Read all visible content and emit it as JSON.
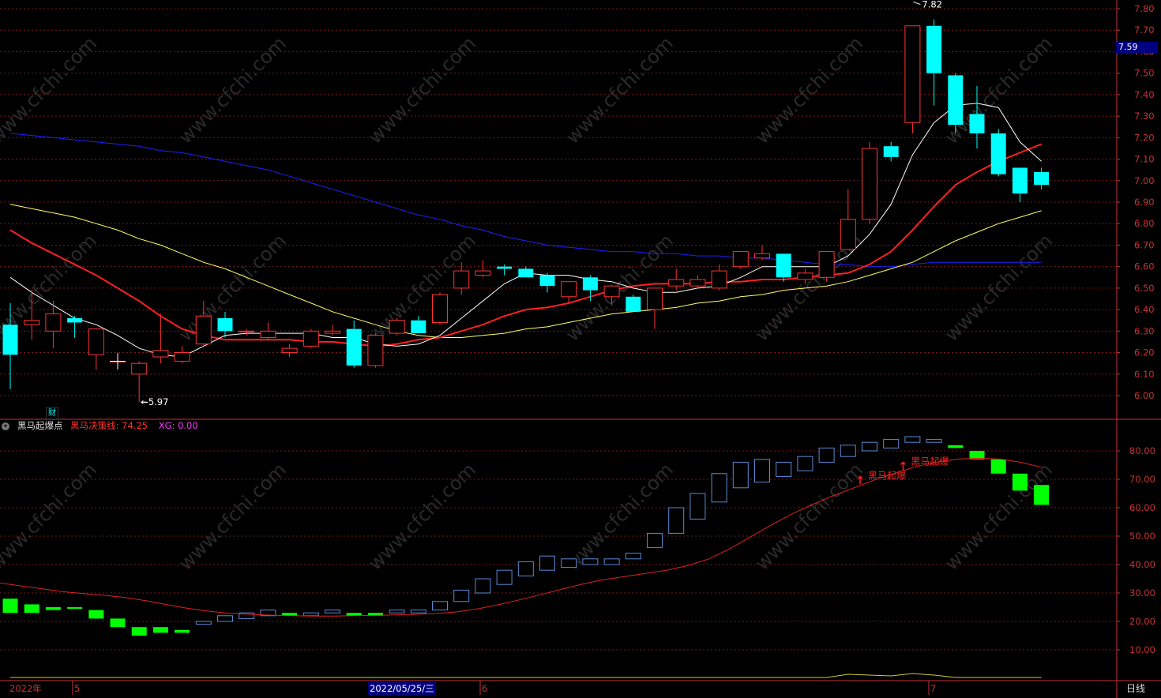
{
  "chart_data": {
    "type": "candlestick",
    "price_axis": {
      "ticks": [
        "7.80",
        "7.70",
        "7.60",
        "7.50",
        "7.40",
        "7.30",
        "7.20",
        "7.10",
        "7.00",
        "6.90",
        "6.80",
        "6.70",
        "6.60",
        "6.50",
        "6.40",
        "6.30",
        "6.20",
        "6.10",
        "6.00"
      ],
      "ylim": [
        5.9,
        7.85
      ]
    },
    "current_price": "7.59",
    "high_marker": "7.82",
    "low_marker": "5.97",
    "candles": [
      [
        6.33,
        6.43,
        6.03,
        6.19
      ],
      [
        6.33,
        6.49,
        6.26,
        6.35
      ],
      [
        6.3,
        6.44,
        6.22,
        6.38
      ],
      [
        6.36,
        6.37,
        6.27,
        6.34
      ],
      [
        6.19,
        6.31,
        6.12,
        6.31
      ],
      [
        6.16,
        6.2,
        6.12,
        6.16
      ],
      [
        6.1,
        6.16,
        5.97,
        6.15
      ],
      [
        6.18,
        6.38,
        6.15,
        6.21
      ],
      [
        6.16,
        6.23,
        6.15,
        6.2
      ],
      [
        6.24,
        6.44,
        6.23,
        6.37
      ],
      [
        6.36,
        6.39,
        6.27,
        6.3
      ],
      [
        6.3,
        6.31,
        6.28,
        6.3
      ],
      [
        6.27,
        6.34,
        6.26,
        6.3
      ],
      [
        6.2,
        6.24,
        6.18,
        6.22
      ],
      [
        6.23,
        6.31,
        6.22,
        6.3
      ],
      [
        6.29,
        6.33,
        6.28,
        6.3
      ],
      [
        6.31,
        6.35,
        6.13,
        6.14
      ],
      [
        6.14,
        6.29,
        6.13,
        6.28
      ],
      [
        6.29,
        6.36,
        6.28,
        6.35
      ],
      [
        6.35,
        6.37,
        6.29,
        6.29
      ],
      [
        6.34,
        6.48,
        6.33,
        6.47
      ],
      [
        6.5,
        6.62,
        6.47,
        6.58
      ],
      [
        6.56,
        6.63,
        6.55,
        6.58
      ],
      [
        6.6,
        6.61,
        6.56,
        6.59
      ],
      [
        6.59,
        6.6,
        6.55,
        6.55
      ],
      [
        6.56,
        6.57,
        6.48,
        6.51
      ],
      [
        6.46,
        6.53,
        6.43,
        6.53
      ],
      [
        6.55,
        6.56,
        6.44,
        6.49
      ],
      [
        6.46,
        6.51,
        6.42,
        6.51
      ],
      [
        6.46,
        6.47,
        6.39,
        6.39
      ],
      [
        6.4,
        6.47,
        6.31,
        6.5
      ],
      [
        6.51,
        6.59,
        6.49,
        6.54
      ],
      [
        6.51,
        6.56,
        6.5,
        6.54
      ],
      [
        6.5,
        6.61,
        6.49,
        6.58
      ],
      [
        6.6,
        6.67,
        6.59,
        6.67
      ],
      [
        6.64,
        6.7,
        6.63,
        6.66
      ],
      [
        6.66,
        6.66,
        6.53,
        6.55
      ],
      [
        6.54,
        6.59,
        6.52,
        6.57
      ],
      [
        6.55,
        6.67,
        6.53,
        6.67
      ],
      [
        6.68,
        6.96,
        6.68,
        6.82
      ],
      [
        6.82,
        7.18,
        6.8,
        7.15
      ],
      [
        7.16,
        7.18,
        7.09,
        7.11
      ],
      [
        7.27,
        7.31,
        7.22,
        7.72
      ],
      [
        7.72,
        7.75,
        7.35,
        7.5
      ],
      [
        7.49,
        7.5,
        7.22,
        7.26
      ],
      [
        7.31,
        7.44,
        7.15,
        7.22
      ],
      [
        7.22,
        7.24,
        7.02,
        7.03
      ],
      [
        7.06,
        7.06,
        6.9,
        6.94
      ],
      [
        7.04,
        7.06,
        6.96,
        6.98
      ]
    ],
    "ma_lines": {
      "ma5_white": [
        6.55,
        6.48,
        6.42,
        6.36,
        6.33,
        6.28,
        6.22,
        6.19,
        6.18,
        6.23,
        6.28,
        6.29,
        6.29,
        6.29,
        6.29,
        6.27,
        6.27,
        6.24,
        6.23,
        6.24,
        6.28,
        6.36,
        6.44,
        6.52,
        6.57,
        6.56,
        6.56,
        6.54,
        6.53,
        6.5,
        6.48,
        6.48,
        6.5,
        6.51,
        6.55,
        6.6,
        6.6,
        6.6,
        6.6,
        6.65,
        6.75,
        6.89,
        7.12,
        7.27,
        7.35,
        7.36,
        7.34,
        7.18,
        7.09
      ],
      "ma10_red": [
        6.77,
        6.71,
        6.66,
        6.61,
        6.56,
        6.5,
        6.44,
        6.37,
        6.31,
        6.28,
        6.26,
        6.26,
        6.26,
        6.26,
        6.25,
        6.25,
        6.24,
        6.23,
        6.24,
        6.26,
        6.27,
        6.3,
        6.33,
        6.37,
        6.4,
        6.41,
        6.43,
        6.46,
        6.49,
        6.51,
        6.52,
        6.52,
        6.52,
        6.53,
        6.53,
        6.54,
        6.54,
        6.55,
        6.56,
        6.57,
        6.61,
        6.67,
        6.77,
        6.88,
        6.98,
        7.04,
        7.09,
        7.13,
        7.17
      ],
      "ma20_yellow": [
        6.89,
        6.87,
        6.85,
        6.83,
        6.8,
        6.77,
        6.73,
        6.7,
        6.66,
        6.62,
        6.59,
        6.55,
        6.51,
        6.47,
        6.43,
        6.39,
        6.36,
        6.33,
        6.3,
        6.28,
        6.27,
        6.27,
        6.28,
        6.29,
        6.31,
        6.32,
        6.34,
        6.36,
        6.38,
        6.39,
        6.4,
        6.41,
        6.43,
        6.44,
        6.46,
        6.47,
        6.49,
        6.5,
        6.51,
        6.53,
        6.56,
        6.59,
        6.62,
        6.67,
        6.72,
        6.76,
        6.8,
        6.83,
        6.86
      ],
      "ma60_blue": [
        7.22,
        7.21,
        7.2,
        7.19,
        7.18,
        7.17,
        7.16,
        7.14,
        7.13,
        7.11,
        7.09,
        7.07,
        7.05,
        7.02,
        6.99,
        6.96,
        6.93,
        6.9,
        6.87,
        6.84,
        6.82,
        6.79,
        6.77,
        6.74,
        6.72,
        6.7,
        6.69,
        6.68,
        6.67,
        6.67,
        6.66,
        6.66,
        6.65,
        6.65,
        6.64,
        6.64,
        6.63,
        6.62,
        6.61,
        6.61,
        6.6,
        6.6,
        6.61,
        6.62,
        6.62,
        6.62,
        6.62,
        6.62,
        6.62
      ]
    },
    "indicator": {
      "name": "黑马起爆点",
      "decision_line_label": "黑马决策线: 74.25",
      "xg_label": "XG: 0.00",
      "ticks": [
        "80.00",
        "70.00",
        "60.00",
        "50.00",
        "40.00",
        "30.00",
        "20.00",
        "10.00"
      ],
      "ylim": [
        0,
        90
      ],
      "bars": [
        [
          28,
          23,
          "g"
        ],
        [
          26,
          23,
          "g"
        ],
        [
          25,
          24,
          "g"
        ],
        [
          25,
          25,
          "g"
        ],
        [
          24,
          21,
          "g"
        ],
        [
          21,
          18,
          "g"
        ],
        [
          18,
          15,
          "g"
        ],
        [
          18,
          16,
          "g"
        ],
        [
          17,
          16,
          "g"
        ],
        [
          19,
          20,
          "b"
        ],
        [
          20,
          22,
          "b"
        ],
        [
          21,
          23,
          "b"
        ],
        [
          22,
          24,
          "b"
        ],
        [
          22,
          23,
          "g"
        ],
        [
          22,
          23,
          "b"
        ],
        [
          23,
          24,
          "b"
        ],
        [
          22,
          23,
          "g"
        ],
        [
          22,
          23,
          "g"
        ],
        [
          23,
          24,
          "b"
        ],
        [
          23,
          24,
          "b"
        ],
        [
          24,
          27,
          "b"
        ],
        [
          27,
          31,
          "b"
        ],
        [
          30,
          35,
          "b"
        ],
        [
          33,
          38,
          "b"
        ],
        [
          36,
          41,
          "b"
        ],
        [
          38,
          43,
          "b"
        ],
        [
          39,
          42,
          "b"
        ],
        [
          40,
          42,
          "b"
        ],
        [
          40,
          42,
          "b"
        ],
        [
          42,
          44,
          "b"
        ],
        [
          46,
          51,
          "b"
        ],
        [
          51,
          60,
          "b"
        ],
        [
          56,
          65,
          "b"
        ],
        [
          62,
          72,
          "b"
        ],
        [
          67,
          76,
          "b"
        ],
        [
          69,
          77,
          "b"
        ],
        [
          71,
          76,
          "b"
        ],
        [
          73,
          78,
          "b"
        ],
        [
          76,
          81,
          "b"
        ],
        [
          78,
          82,
          "b"
        ],
        [
          80,
          83,
          "b"
        ],
        [
          81,
          84,
          "b"
        ],
        [
          83,
          85,
          "b"
        ],
        [
          83,
          84,
          "b"
        ],
        [
          82,
          81,
          "g"
        ],
        [
          80,
          77,
          "g"
        ],
        [
          77,
          72,
          "g"
        ],
        [
          72,
          66,
          "g"
        ],
        [
          68,
          61,
          "g"
        ]
      ],
      "decision_line": [
        33.5,
        32.5,
        31.5,
        30.5,
        29.8,
        29.2,
        28.4,
        27.3,
        25.9,
        24.6,
        23.6,
        22.9,
        22.5,
        22.2,
        22.0,
        21.9,
        21.9,
        22.0,
        22.1,
        22.3,
        22.5,
        22.8,
        23.4,
        24.5,
        26.0,
        27.7,
        29.5,
        31.4,
        33.2,
        34.7,
        35.8,
        36.9,
        38.0,
        39.6,
        41.9,
        45.4,
        49.6,
        53.8,
        57.7,
        61.1,
        64.2,
        67.0,
        69.8,
        72.2,
        74.5,
        76.1,
        77.1,
        77.4,
        77.1,
        76.0,
        74.25
      ],
      "signals": [
        {
          "text": "黑马起爆"
        },
        {
          "text": "黑马起爆"
        }
      ]
    },
    "volume_line": [
      0,
      0,
      0,
      0,
      0,
      0,
      0,
      0,
      0,
      0,
      0,
      0,
      0,
      0,
      0,
      0,
      0,
      0,
      0,
      0,
      0,
      0,
      0,
      0,
      0,
      0,
      0,
      0,
      0,
      0,
      0,
      0,
      0,
      0,
      0,
      0,
      0,
      0,
      0,
      4,
      3,
      2,
      5,
      3,
      0,
      0,
      0,
      0,
      0
    ],
    "x_labels": {
      "year": "2022年",
      "m5": "5",
      "m6": "6",
      "m7": "7",
      "cursor_date": "2022/05/25/三"
    },
    "period": "日线",
    "badge": "财",
    "watermark": "www.cfchi.com",
    "colors": {
      "up": "#ff3232",
      "down": "#00ffff",
      "ind_up": "#5a8ad6",
      "ind_down": "#00ff00",
      "ma5": "#ffffff",
      "ma10": "#ff2020",
      "ma20": "#ffff66",
      "ma60": "#2020ff",
      "grid": "#7a1a1a",
      "axis": "#c83232"
    }
  }
}
